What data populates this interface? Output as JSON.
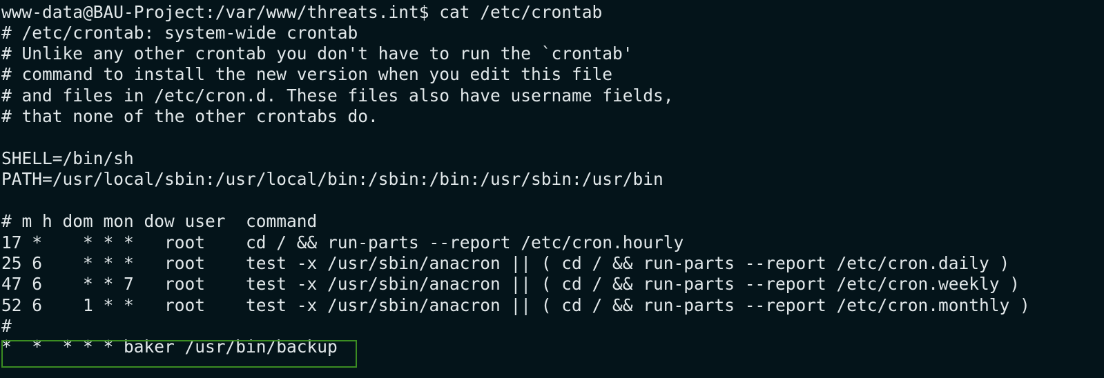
{
  "terminal": {
    "lines": [
      "www-data@BAU-Project:/var/www/threats.int$ cat /etc/crontab",
      "# /etc/crontab: system-wide crontab",
      "# Unlike any other crontab you don't have to run the `crontab'",
      "# command to install the new version when you edit this file",
      "# and files in /etc/cron.d. These files also have username fields,",
      "# that none of the other crontabs do.",
      "",
      "SHELL=/bin/sh",
      "PATH=/usr/local/sbin:/usr/local/bin:/sbin:/bin:/usr/sbin:/usr/bin",
      "",
      "# m h dom mon dow user  command",
      "17 *    * * *   root    cd / && run-parts --report /etc/cron.hourly",
      "25 6    * * *   root    test -x /usr/sbin/anacron || ( cd / && run-parts --report /etc/cron.daily )",
      "47 6    * * 7   root    test -x /usr/sbin/anacron || ( cd / && run-parts --report /etc/cron.weekly )",
      "52 6    1 * *   root    test -x /usr/sbin/anacron || ( cd / && run-parts --report /etc/cron.monthly )",
      "#",
      "*  *  * * * baker /usr/bin/backup"
    ]
  },
  "colors": {
    "background": "#04141a",
    "text": "#e2e8ea",
    "highlight_border": "#3b8d22"
  }
}
